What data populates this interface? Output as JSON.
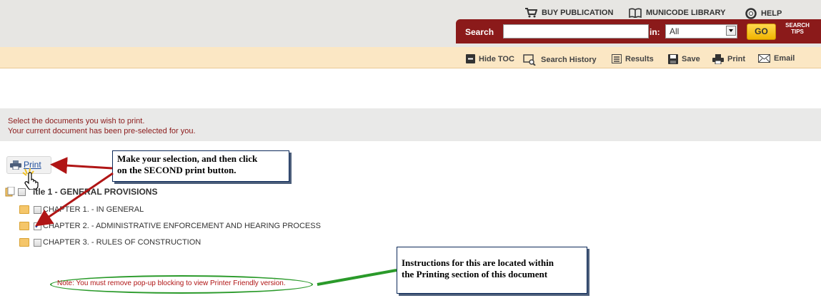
{
  "header": {
    "links": [
      {
        "label": "BUY PUBLICATION",
        "icon": "cart-icon"
      },
      {
        "label": "MUNICODE LIBRARY",
        "icon": "book-icon"
      },
      {
        "label": "HELP",
        "icon": "lifebuoy-icon"
      }
    ],
    "search": {
      "label": "Search",
      "value": "",
      "in_label": "in:",
      "scope_value": "All",
      "go_label": "GO",
      "tips_line1": "SEARCH",
      "tips_line2": "TIPS"
    }
  },
  "toolbar": {
    "items": [
      {
        "label": "Hide TOC",
        "icon": "minus-square-icon"
      },
      {
        "label": "Search History",
        "icon": "search-history-icon"
      },
      {
        "label": "Results",
        "icon": "list-icon"
      },
      {
        "label": "Save",
        "icon": "floppy-icon"
      },
      {
        "label": "Print",
        "icon": "printer-icon"
      },
      {
        "label": "Email",
        "icon": "envelope-icon"
      }
    ]
  },
  "instructions": {
    "line1": "Select the documents you wish to print.",
    "line2": "Your current document has been pre-selected for you."
  },
  "print_button": {
    "label": "Print"
  },
  "tree": {
    "root": {
      "label": "Title 1 - GENERAL PROVISIONS",
      "visible_label": "itle 1 - GENERAL PROVISIONS",
      "checked": false
    },
    "children": [
      {
        "label": "CHAPTER 1. - IN GENERAL",
        "checked": false
      },
      {
        "label": "CHAPTER 2. - ADMINISTRATIVE ENFORCEMENT AND HEARING PROCESS",
        "checked": true
      },
      {
        "label": "CHAPTER 3. - RULES OF CONSTRUCTION",
        "checked": false
      }
    ]
  },
  "callouts": {
    "selection_line1": "Make your selection, and then click",
    "selection_line2": "on the SECOND print button.",
    "instructions_line1": "Instructions for this are located within",
    "instructions_line2": "the Printing section of this document"
  },
  "note": "Note: You must remove pop-up blocking to view Printer Friendly version.",
  "colors": {
    "header_bg": "#e7e6e3",
    "search_bar": "#8b1a1a",
    "toolbar_bg": "#fbe7c4",
    "go_button": "#f0b400",
    "instruction_text": "#8b1a1a",
    "arrow_red": "#b01515",
    "arrow_green": "#2a9a2a"
  }
}
